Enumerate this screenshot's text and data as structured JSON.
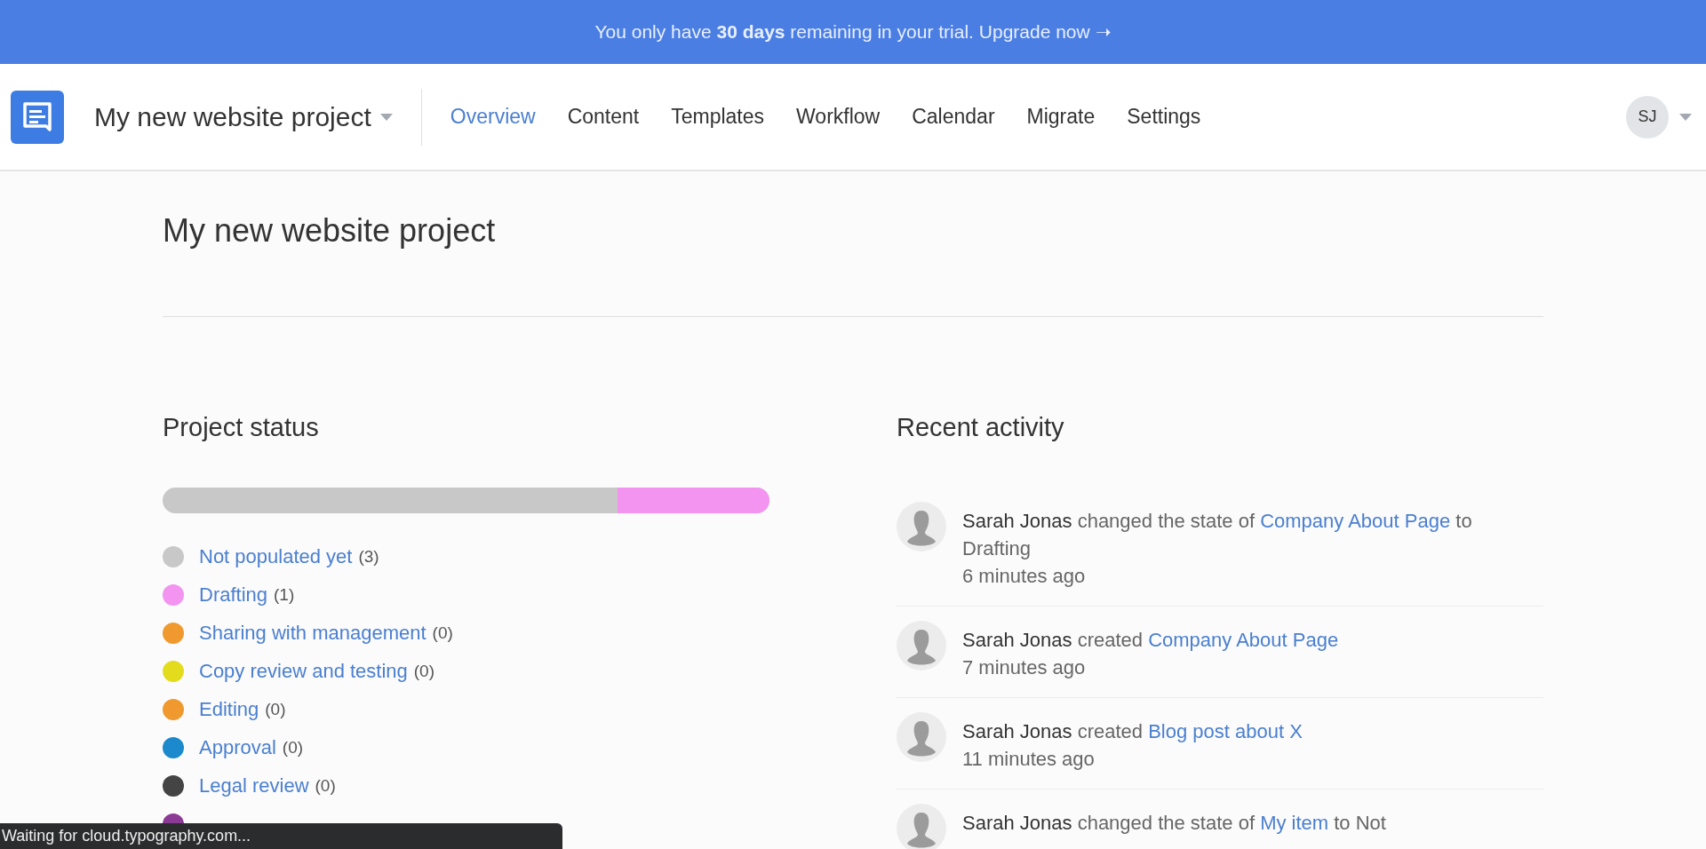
{
  "banner": {
    "text": "You only have **30 days** remaining in your trial. Upgrade now ➝"
  },
  "header": {
    "project": "My new website project",
    "nav": [
      {
        "label": "Overview",
        "selected": true
      },
      {
        "label": "Content",
        "selected": false
      },
      {
        "label": "Templates",
        "selected": false
      },
      {
        "label": "Workflow",
        "selected": false
      },
      {
        "label": "Calendar",
        "selected": false
      },
      {
        "label": "Migrate",
        "selected": false
      },
      {
        "label": "Settings",
        "selected": false
      }
    ],
    "avatar": "SJ"
  },
  "page_title": "My new website project",
  "project_status": {
    "title": "Project status",
    "bar": {
      "level": 0.25
    },
    "states": [
      {
        "label": "Not populated yet",
        "count": "(3)",
        "color": "#c8c8c8"
      },
      {
        "label": "Drafting",
        "count": "(1)",
        "color": "#f294f0"
      },
      {
        "label": "Sharing with management",
        "count": "(0)",
        "color": "#f0992e"
      },
      {
        "label": "Copy review and testing",
        "count": "(0)",
        "color": "#e3dc1c"
      },
      {
        "label": "Editing",
        "count": "(0)",
        "color": "#f0992e"
      },
      {
        "label": "Approval",
        "count": "(0)",
        "color": "#1b89cc"
      },
      {
        "label": "Legal review",
        "count": "(0)",
        "color": "#444444"
      },
      {
        "color": "#8b3a95"
      }
    ]
  },
  "recent_activity": {
    "title": "Recent activity",
    "items": [
      {
        "actor": "Sarah Jonas",
        "action": "changed the state of",
        "target": "Company About Page",
        "rest": "to Drafting",
        "time": "6 minutes ago"
      },
      {
        "actor": "Sarah Jonas",
        "action": "created",
        "target": "Company About Page",
        "time": "7 minutes ago"
      },
      {
        "actor": "Sarah Jonas",
        "action": "created",
        "target": "Blog post about X",
        "time": "11 minutes ago"
      },
      {
        "actor": "Sarah Jonas",
        "action": "changed the state of",
        "target": "My item",
        "rest": "to Not"
      }
    ]
  },
  "status_bar": "Waiting for cloud.typography.com..."
}
